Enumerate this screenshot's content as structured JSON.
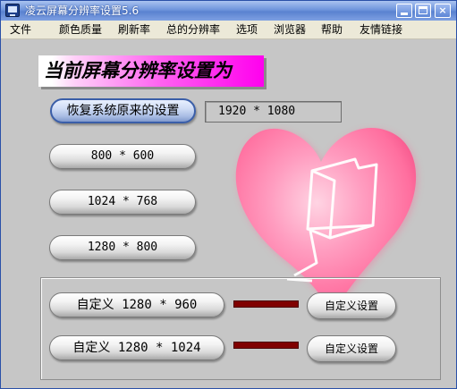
{
  "window": {
    "title": "凌云屏幕分辨率设置5.6",
    "controls": {
      "minimize": "minimize",
      "maximize": "maximize",
      "close": "×"
    }
  },
  "menu": [
    "文件",
    "颜色质量",
    "刷新率",
    "总的分辨率",
    "选项",
    "浏览器",
    "帮助",
    "友情链接"
  ],
  "main": {
    "heading": "当前屏幕分辨率设置为",
    "current_resolution": "1920 * 1080",
    "restore_button": "恢复系统原来的设置",
    "presets": [
      "800 * 600",
      "1024 * 768",
      "1280 * 800"
    ],
    "custom": [
      {
        "label": "自定义 1280 * 960",
        "settings_button": "自定义设置",
        "color": "#800000"
      },
      {
        "label": "自定义 1280 * 1024",
        "settings_button": "自定义设置",
        "color": "#800000"
      }
    ]
  },
  "colors": {
    "titlebar": "#6f95dc",
    "menubar": "#ece9d8",
    "client": "#c6c6c6",
    "heading_gradient_end": "#ff00ee",
    "heart": "#ff7fae",
    "custom_bar": "#800000"
  },
  "icons": {
    "app": "monitor-icon",
    "heart": "heart-folder-icon"
  }
}
